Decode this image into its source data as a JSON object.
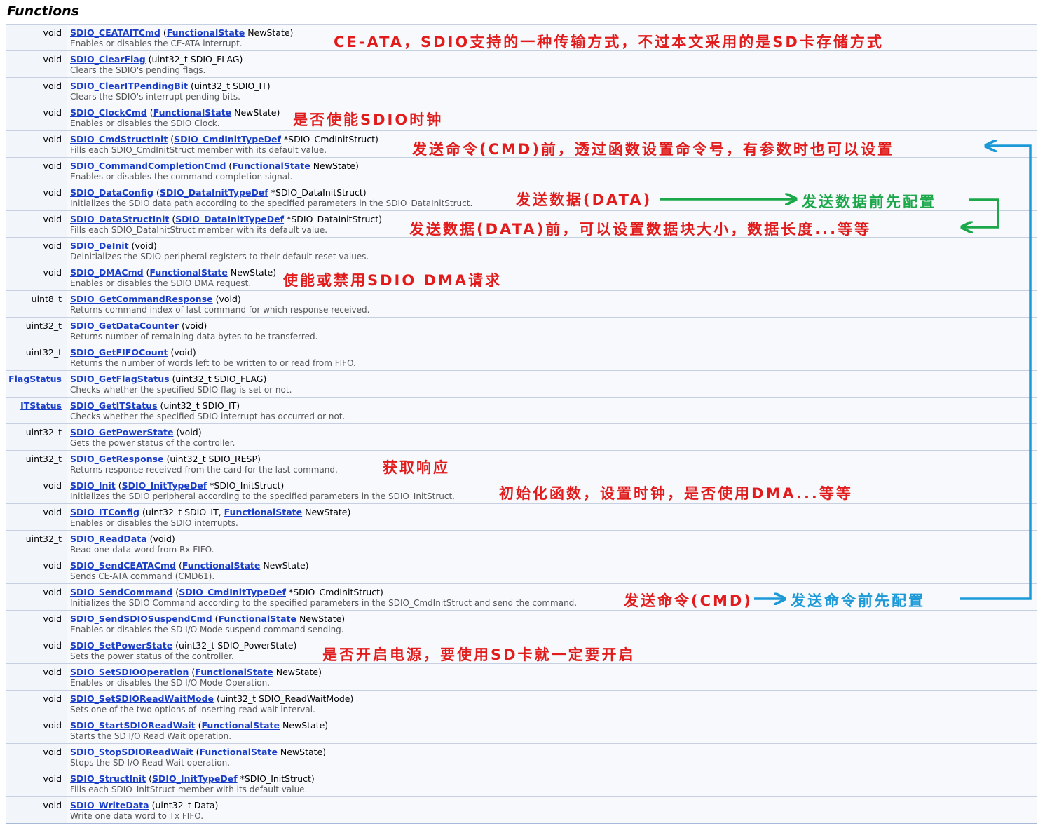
{
  "title": "Functions",
  "functions": [
    {
      "ret": "void",
      "name": "SDIO_CEATAITCmd",
      "args": [
        {
          "t": " ("
        },
        {
          "t": "FunctionalState",
          "link": true
        },
        {
          "t": " NewState)"
        }
      ],
      "desc": "Enables or disables the CE-ATA interrupt."
    },
    {
      "ret": "void",
      "name": "SDIO_ClearFlag",
      "args": [
        {
          "t": " (uint32_t SDIO_FLAG)"
        }
      ],
      "desc": "Clears the SDIO's pending flags."
    },
    {
      "ret": "void",
      "name": "SDIO_ClearITPendingBit",
      "args": [
        {
          "t": " (uint32_t SDIO_IT)"
        }
      ],
      "desc": "Clears the SDIO's interrupt pending bits."
    },
    {
      "ret": "void",
      "name": "SDIO_ClockCmd",
      "args": [
        {
          "t": " ("
        },
        {
          "t": "FunctionalState",
          "link": true
        },
        {
          "t": " NewState)"
        }
      ],
      "desc": "Enables or disables the SDIO Clock."
    },
    {
      "ret": "void",
      "name": "SDIO_CmdStructInit",
      "args": [
        {
          "t": " ("
        },
        {
          "t": "SDIO_CmdInitTypeDef",
          "link": true
        },
        {
          "t": " *SDIO_CmdInitStruct)"
        }
      ],
      "desc": "Fills each SDIO_CmdInitStruct member with its default value."
    },
    {
      "ret": "void",
      "name": "SDIO_CommandCompletionCmd",
      "args": [
        {
          "t": " ("
        },
        {
          "t": "FunctionalState",
          "link": true
        },
        {
          "t": " NewState)"
        }
      ],
      "desc": "Enables or disables the command completion signal."
    },
    {
      "ret": "void",
      "name": "SDIO_DataConfig",
      "args": [
        {
          "t": " ("
        },
        {
          "t": "SDIO_DataInitTypeDef",
          "link": true
        },
        {
          "t": " *SDIO_DataInitStruct)"
        }
      ],
      "desc": "Initializes the SDIO data path according to the specified parameters in the SDIO_DataInitStruct."
    },
    {
      "ret": "void",
      "name": "SDIO_DataStructInit",
      "args": [
        {
          "t": " ("
        },
        {
          "t": "SDIO_DataInitTypeDef",
          "link": true
        },
        {
          "t": " *SDIO_DataInitStruct)"
        }
      ],
      "desc": "Fills each SDIO_DataInitStruct member with its default value."
    },
    {
      "ret": "void",
      "name": "SDIO_DeInit",
      "args": [
        {
          "t": " (void)"
        }
      ],
      "desc": "Deinitializes the SDIO peripheral registers to their default reset values."
    },
    {
      "ret": "void",
      "name": "SDIO_DMACmd",
      "args": [
        {
          "t": " ("
        },
        {
          "t": "FunctionalState",
          "link": true
        },
        {
          "t": " NewState)"
        }
      ],
      "desc": "Enables or disables the SDIO DMA request."
    },
    {
      "ret": "uint8_t",
      "name": "SDIO_GetCommandResponse",
      "args": [
        {
          "t": " (void)"
        }
      ],
      "desc": "Returns command index of last command for which response received."
    },
    {
      "ret": "uint32_t",
      "name": "SDIO_GetDataCounter",
      "args": [
        {
          "t": " (void)"
        }
      ],
      "desc": "Returns number of remaining data bytes to be transferred."
    },
    {
      "ret": "uint32_t",
      "name": "SDIO_GetFIFOCount",
      "args": [
        {
          "t": " (void)"
        }
      ],
      "desc": "Returns the number of words left to be written to or read from FIFO."
    },
    {
      "ret": "FlagStatus",
      "retLink": true,
      "name": "SDIO_GetFlagStatus",
      "args": [
        {
          "t": " (uint32_t SDIO_FLAG)"
        }
      ],
      "desc": "Checks whether the specified SDIO flag is set or not."
    },
    {
      "ret": "ITStatus",
      "retLink": true,
      "name": "SDIO_GetITStatus",
      "args": [
        {
          "t": " (uint32_t SDIO_IT)"
        }
      ],
      "desc": "Checks whether the specified SDIO interrupt has occurred or not."
    },
    {
      "ret": "uint32_t",
      "name": "SDIO_GetPowerState",
      "args": [
        {
          "t": " (void)"
        }
      ],
      "desc": "Gets the power status of the controller."
    },
    {
      "ret": "uint32_t",
      "name": "SDIO_GetResponse",
      "args": [
        {
          "t": " (uint32_t SDIO_RESP)"
        }
      ],
      "desc": "Returns response received from the card for the last command."
    },
    {
      "ret": "void",
      "name": "SDIO_Init",
      "args": [
        {
          "t": " ("
        },
        {
          "t": "SDIO_InitTypeDef",
          "link": true
        },
        {
          "t": " *SDIO_InitStruct)"
        }
      ],
      "desc": "Initializes the SDIO peripheral according to the specified parameters in the SDIO_InitStruct."
    },
    {
      "ret": "void",
      "name": "SDIO_ITConfig",
      "args": [
        {
          "t": " (uint32_t SDIO_IT, "
        },
        {
          "t": "FunctionalState",
          "link": true
        },
        {
          "t": " NewState)"
        }
      ],
      "desc": "Enables or disables the SDIO interrupts."
    },
    {
      "ret": "uint32_t",
      "name": "SDIO_ReadData",
      "args": [
        {
          "t": " (void)"
        }
      ],
      "desc": "Read one data word from Rx FIFO."
    },
    {
      "ret": "void",
      "name": "SDIO_SendCEATACmd",
      "args": [
        {
          "t": " ("
        },
        {
          "t": "FunctionalState",
          "link": true
        },
        {
          "t": " NewState)"
        }
      ],
      "desc": "Sends CE-ATA command (CMD61)."
    },
    {
      "ret": "void",
      "name": "SDIO_SendCommand",
      "args": [
        {
          "t": " ("
        },
        {
          "t": "SDIO_CmdInitTypeDef",
          "link": true
        },
        {
          "t": " *SDIO_CmdInitStruct)"
        }
      ],
      "desc": "Initializes the SDIO Command according to the specified parameters in the SDIO_CmdInitStruct and send the command."
    },
    {
      "ret": "void",
      "name": "SDIO_SendSDIOSuspendCmd",
      "args": [
        {
          "t": " ("
        },
        {
          "t": "FunctionalState",
          "link": true
        },
        {
          "t": " NewState)"
        }
      ],
      "desc": "Enables or disables the SD I/O Mode suspend command sending."
    },
    {
      "ret": "void",
      "name": "SDIO_SetPowerState",
      "args": [
        {
          "t": " (uint32_t SDIO_PowerState)"
        }
      ],
      "desc": "Sets the power status of the controller."
    },
    {
      "ret": "void",
      "name": "SDIO_SetSDIOOperation",
      "args": [
        {
          "t": " ("
        },
        {
          "t": "FunctionalState",
          "link": true
        },
        {
          "t": " NewState)"
        }
      ],
      "desc": "Enables or disables the SD I/O Mode Operation."
    },
    {
      "ret": "void",
      "name": "SDIO_SetSDIOReadWaitMode",
      "args": [
        {
          "t": " (uint32_t SDIO_ReadWaitMode)"
        }
      ],
      "desc": "Sets one of the two options of inserting read wait interval."
    },
    {
      "ret": "void",
      "name": "SDIO_StartSDIOReadWait",
      "args": [
        {
          "t": " ("
        },
        {
          "t": "FunctionalState",
          "link": true
        },
        {
          "t": " NewState)"
        }
      ],
      "desc": "Starts the SD I/O Read Wait operation."
    },
    {
      "ret": "void",
      "name": "SDIO_StopSDIOReadWait",
      "args": [
        {
          "t": " ("
        },
        {
          "t": "FunctionalState",
          "link": true
        },
        {
          "t": " NewState)"
        }
      ],
      "desc": "Stops the SD I/O Read Wait operation."
    },
    {
      "ret": "void",
      "name": "SDIO_StructInit",
      "args": [
        {
          "t": " ("
        },
        {
          "t": "SDIO_InitTypeDef",
          "link": true
        },
        {
          "t": " *SDIO_InitStruct)"
        }
      ],
      "desc": "Fills each SDIO_InitStruct member with its default value."
    },
    {
      "ret": "void",
      "name": "SDIO_WriteData",
      "args": [
        {
          "t": " (uint32_t Data)"
        }
      ],
      "desc": "Write one data word to Tx FIFO."
    }
  ],
  "annotations": {
    "ceata": "CE-ATA，SDIO支持的一种传输方式，不过本文采用的是SD卡存储方式",
    "clock": "是否使能SDIO时钟",
    "cmdstruct": "发送命令(CMD)前，透过函数设置命令号，有参数时也可以设置",
    "send_data": "发送数据(DATA)",
    "data_preconfig": "发送数据前先配置",
    "datastruct": "发送数据(DATA)前，可以设置数据块大小，数据长度...等等",
    "dma": "使能或禁用SDIO DMA请求",
    "response": "获取响应",
    "init": "初始化函数，设置时钟，是否使用DMA...等等",
    "send_cmd": "发送命令(CMD)",
    "cmd_preconfig": "发送命令前先配置",
    "power": "是否开启电源，要使用SD卡就一定要开启"
  },
  "colors": {
    "red": "#e21c1c",
    "green": "#1aa84a",
    "blue": "#1c9ad8",
    "link": "#1a3ec8"
  }
}
